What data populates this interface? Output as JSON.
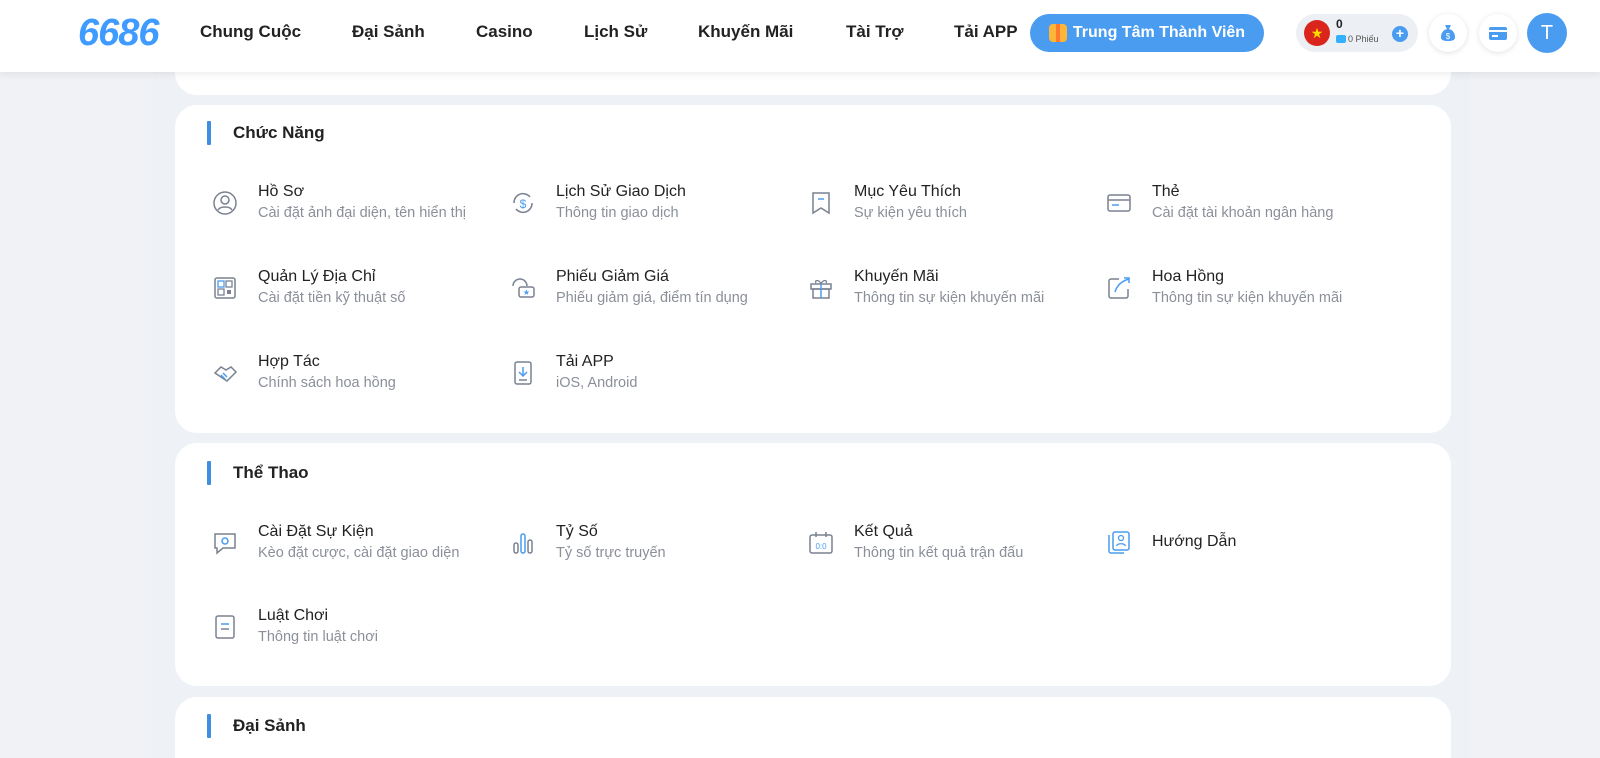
{
  "logo": "6686",
  "nav": [
    {
      "label": "Chung Cuộc"
    },
    {
      "label": "Đại Sảnh"
    },
    {
      "label": "Casino"
    },
    {
      "label": "Lịch Sử"
    },
    {
      "label": "Khuyến Mãi"
    },
    {
      "label": "Tài Trợ"
    },
    {
      "label": "Tải APP"
    }
  ],
  "member_center": "Trung Tâm Thành Viên",
  "wallet": {
    "balance": "0",
    "coupons": "0 Phiếu",
    "flag": "★"
  },
  "avatar_letter": "T",
  "sections": {
    "functions": {
      "title": "Chức Năng",
      "items": [
        {
          "title": "Hồ Sơ",
          "desc": "Cài đặt ảnh đại diện, tên hiển thị",
          "icon": "profile-icon"
        },
        {
          "title": "Lịch Sử Giao Dịch",
          "desc": "Thông tin giao dịch",
          "icon": "transaction-icon"
        },
        {
          "title": "Mục Yêu Thích",
          "desc": "Sự kiện yêu thích",
          "icon": "bookmark-icon"
        },
        {
          "title": "Thẻ",
          "desc": "Cài đặt tài khoản ngân hàng",
          "icon": "card-icon"
        },
        {
          "title": "Quản Lý Địa Chỉ",
          "desc": "Cài đặt tiền kỹ thuật số",
          "icon": "qr-icon"
        },
        {
          "title": "Phiếu Giảm Giá",
          "desc": "Phiếu giảm giá, điểm tín dụng",
          "icon": "coupon-icon"
        },
        {
          "title": "Khuyến Mãi",
          "desc": "Thông tin sự kiện khuyến mãi",
          "icon": "gift-icon"
        },
        {
          "title": "Hoa Hồng",
          "desc": "Thông tin sự kiện khuyến mãi",
          "icon": "commission-icon"
        },
        {
          "title": "Hợp Tác",
          "desc": "Chính sách hoa hồng",
          "icon": "handshake-icon"
        },
        {
          "title": "Tải APP",
          "desc": "iOS, Android",
          "icon": "download-icon"
        }
      ]
    },
    "sports": {
      "title": "Thể Thao",
      "items": [
        {
          "title": "Cài Đặt Sự Kiện",
          "desc": "Kèo đặt cược, cài đặt giao diện",
          "icon": "settings-chat-icon"
        },
        {
          "title": "Tỷ Số",
          "desc": "Tỷ số trực truyến",
          "icon": "bar-chart-icon"
        },
        {
          "title": "Kết Quả",
          "desc": "Thông tin kết quả trận đấu",
          "icon": "scoreboard-icon"
        },
        {
          "title": "Hướng Dẫn",
          "desc": "",
          "icon": "guide-icon"
        },
        {
          "title": "Luật Chơi",
          "desc": "Thông tin luật chơi",
          "icon": "rules-icon"
        }
      ]
    },
    "hall": {
      "title": "Đại Sảnh"
    }
  }
}
